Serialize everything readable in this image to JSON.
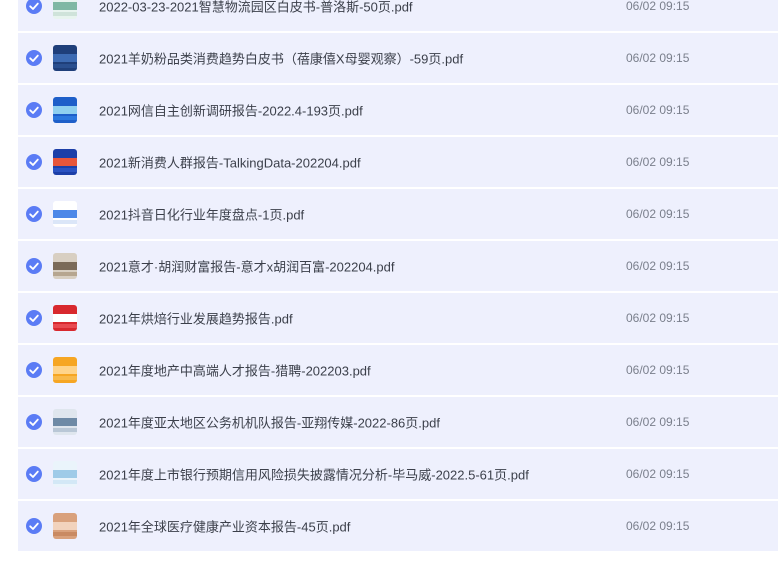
{
  "files": [
    {
      "name": "2022-03-23-2021智慧物流园区白皮书-普洛斯-50页.pdf",
      "time": "06/02 09:15",
      "thumb_colors": [
        "#e8f4ef",
        "#7fb8a4",
        "#cfe3da"
      ],
      "selected": true
    },
    {
      "name": "2021羊奶粉品类消费趋势白皮书（蓓康僖X母婴观察）-59页.pdf",
      "time": "06/02 09:15",
      "thumb_colors": [
        "#1f3f7a",
        "#3d6bb3",
        "#2a4f8f"
      ],
      "selected": true
    },
    {
      "name": "2021网信自主创新调研报告-2022.4-193页.pdf",
      "time": "06/02 09:15",
      "thumb_colors": [
        "#1e5fc9",
        "#8fd0f0",
        "#2c78de"
      ],
      "selected": true
    },
    {
      "name": "2021新消费人群报告-TalkingData-202204.pdf",
      "time": "06/02 09:15",
      "thumb_colors": [
        "#1c3fa8",
        "#e8563a",
        "#2a52c2"
      ],
      "selected": true
    },
    {
      "name": "2021抖音日化行业年度盘点-1页.pdf",
      "time": "06/02 09:15",
      "thumb_colors": [
        "#ffffff",
        "#4d88e8",
        "#dbe6f8"
      ],
      "selected": true
    },
    {
      "name": "2021意才·胡润财富报告-意才x胡润百富-202204.pdf",
      "time": "06/02 09:15",
      "thumb_colors": [
        "#d8cfc2",
        "#7a6a58",
        "#b6a690"
      ],
      "selected": true
    },
    {
      "name": "2021年烘焙行业发展趋势报告.pdf",
      "time": "06/02 09:15",
      "thumb_colors": [
        "#d8282e",
        "#ffffff",
        "#e84a50"
      ],
      "selected": true
    },
    {
      "name": "2021年度地产中高端人才报告-猎聘-202203.pdf",
      "time": "06/02 09:15",
      "thumb_colors": [
        "#f6a623",
        "#ffd48a",
        "#f8b94a"
      ],
      "selected": true
    },
    {
      "name": "2021年度亚太地区公务机机队报告-亚翔传媒-2022-86页.pdf",
      "time": "06/02 09:15",
      "thumb_colors": [
        "#dfe6ee",
        "#6e8aa6",
        "#b9c7d6"
      ],
      "selected": true
    },
    {
      "name": "2021年度上市银行预期信用风险损失披露情况分析-毕马威-2022.5-61页.pdf",
      "time": "06/02 09:15",
      "thumb_colors": [
        "#eaf4fb",
        "#9fcbe8",
        "#d3e8f6"
      ],
      "selected": true
    },
    {
      "name": "2021年全球医疗健康产业资本报告-45页.pdf",
      "time": "06/02 09:15",
      "thumb_colors": [
        "#d9a17c",
        "#f2d3bd",
        "#c98a62"
      ],
      "selected": true
    }
  ],
  "colors": {
    "row_bg": "#eef0fd",
    "check": "#5b7cf5"
  }
}
